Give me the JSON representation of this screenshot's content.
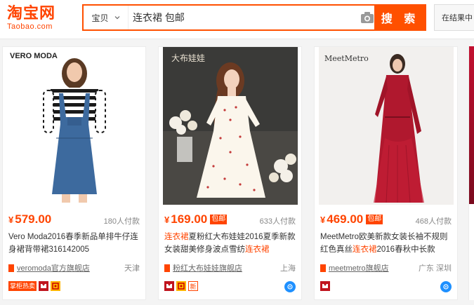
{
  "header": {
    "logo_cn": "淘宝网",
    "logo_en": "Taobao.com",
    "search_scope": "宝贝",
    "search_query": "连衣裙 包邮",
    "search_button": "搜 索",
    "within_results": "在结果中"
  },
  "products": [
    {
      "brand_label": "VERO MODA",
      "price_symbol": "¥",
      "price": "579.00",
      "sales": "180人付款",
      "title_parts": [
        "Vero Moda2016春季新品单排牛仔连身裙背带裙316142005"
      ],
      "shop": "veromoda官方旗舰店",
      "location": "天津",
      "badges": [
        "掌柜热卖"
      ]
    },
    {
      "brand_label": "大布娃娃",
      "price_symbol": "¥",
      "price": "169.00",
      "baoyou": "包邮",
      "sales": "633人付款",
      "title_hl_1": "连衣裙",
      "title_mid": "夏粉红大布娃娃2016夏季新款女装甜美修身波点雪纺",
      "title_hl_2": "连衣裙",
      "shop": "粉红大布娃娃旗舰店",
      "location": "上海",
      "badge_new": "新"
    },
    {
      "brand_label": "MeetMetro",
      "price_symbol": "¥",
      "price": "469.00",
      "baoyou": "包邮",
      "sales": "468人付款",
      "title_pre": "MeetMetro欧美新款女装长袖不规则红色真丝",
      "title_hl": "连衣裙",
      "title_post": "2016春秋中长款",
      "shop": "meetmetro旗舰店",
      "location": "广东 深圳"
    }
  ],
  "colors": {
    "accent": "#ff4400",
    "search_border": "#ff5000",
    "wangwang": "#1e90ff"
  },
  "icons": [
    "chevron-down-icon",
    "camera-icon",
    "shop-icon",
    "tmall-icon",
    "gold-seller-icon",
    "wangwang-icon"
  ]
}
